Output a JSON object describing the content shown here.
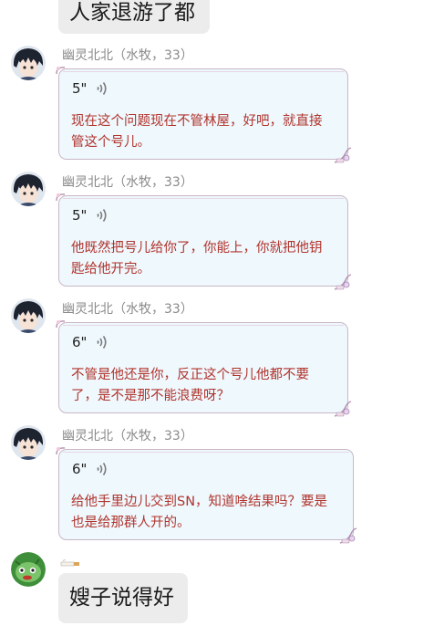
{
  "top_message": {
    "text": "人家退游了都"
  },
  "voice_messages": [
    {
      "sender": "幽灵北北（水牧，33）",
      "duration": "5\"",
      "transcript": "现在这个问题现在不管林屋，好吧，就直接管这个号儿。"
    },
    {
      "sender": "幽灵北北（水牧，33）",
      "duration": "5\"",
      "transcript": "他既然把号儿给你了，你能上，你就把他钥匙给他开完。"
    },
    {
      "sender": "幽灵北北（水牧，33）",
      "duration": "6\"",
      "transcript": "不管是他还是你，反正这个号儿他都不要了，是不是那不能浪费呀？"
    },
    {
      "sender": "幽灵北北（水牧，33）",
      "duration": "6\"",
      "transcript": "给他手里边儿交到SN，知道啥结果吗？要是也是给那群人开的。"
    }
  ],
  "last_message": {
    "text": "嫂子说得好"
  },
  "icons": {
    "voice": "speaker-wave-icon",
    "avatar_1": "anime-boy-avatar",
    "avatar_2": "green-creature-avatar",
    "badge": "cigarette-badge-icon"
  },
  "colors": {
    "transcript": "#b1342d",
    "card_bg": "#eef8fd",
    "card_border": "#c9b6c6",
    "plain_bubble": "#ececec"
  }
}
